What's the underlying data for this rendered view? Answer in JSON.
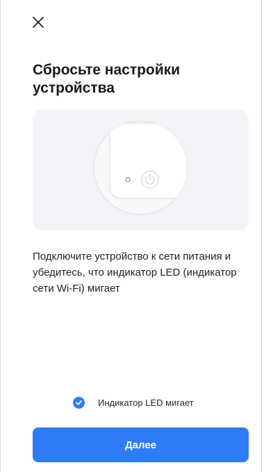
{
  "header": {
    "close_icon": "close-icon"
  },
  "page": {
    "title": "Сбросьте настройки устройства",
    "instruction": "Подключите устройство к сети питания и убедитесь, что индикатор LED (индикатор сети Wi-Fi) мигает"
  },
  "illustration": {
    "icons": [
      "indicator-led-icon",
      "power-button-icon"
    ],
    "background_color": "#f2f3f6"
  },
  "confirm": {
    "checked": true,
    "label": "Индикатор LED мигает",
    "icon": "check-circle-icon"
  },
  "footer": {
    "next_label": "Далее"
  },
  "colors": {
    "accent": "#2f7bf6",
    "text": "#1a1a1a"
  }
}
